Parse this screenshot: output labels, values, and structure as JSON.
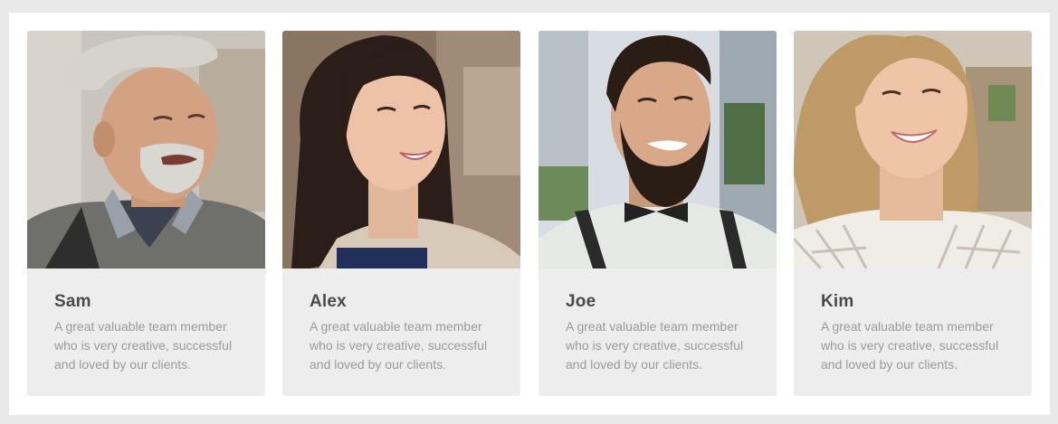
{
  "team": {
    "members": [
      {
        "name": "Sam",
        "description": "A great valuable team member who is very creative, successful and loved by our clients.",
        "photo_icon": "portrait-older-man-cap"
      },
      {
        "name": "Alex",
        "description": "A great valuable team member who is very creative, successful and loved by our clients.",
        "photo_icon": "portrait-woman-dark-hair"
      },
      {
        "name": "Joe",
        "description": "A great valuable team member who is very creative, successful and loved by our clients.",
        "photo_icon": "portrait-bearded-man-bowtie"
      },
      {
        "name": "Kim",
        "description": "A great valuable team member who is very creative, successful and loved by our clients.",
        "photo_icon": "portrait-woman-blonde"
      }
    ]
  },
  "colors": {
    "page_background": "#e9e9e9",
    "panel_background": "#ffffff",
    "card_background": "#ededed",
    "name_text": "#4a4a4a",
    "description_text": "#9a9a9a"
  }
}
